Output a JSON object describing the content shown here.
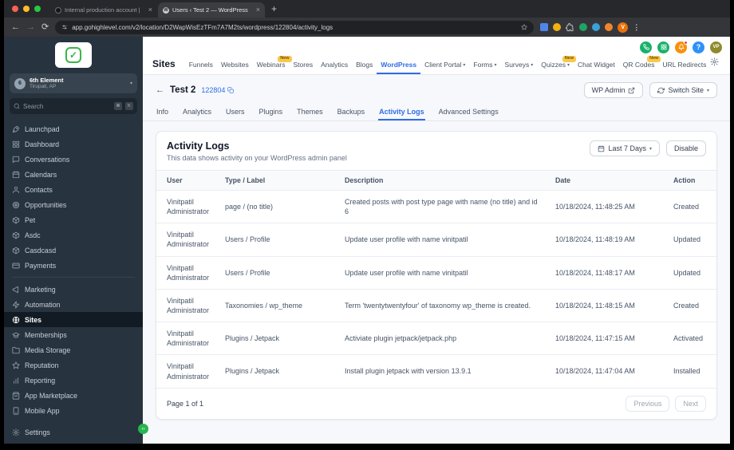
{
  "colors": {
    "accent": "#2f6ce5",
    "sidebar_bg": "#27333f",
    "sidebar_active_bg": "#121a23",
    "badge_bg": "#f7c948",
    "badge_text": "#7a4d0b",
    "green": "#17b26a",
    "orange": "#f79009",
    "blue": "#2e90fa"
  },
  "browser": {
    "tabs": [
      {
        "title": "Internal production account |"
      },
      {
        "title": "Users ‹ Test 2 — WordPress"
      }
    ],
    "url": "app.gohighlevel.com/v2/location/D2WapWisEzTFm7A7M2ts/wordpress/122804/activity_logs",
    "profile_initial": "V"
  },
  "sidebar": {
    "location_name": "6th Element",
    "location_sub": "Tirupati, AP",
    "location_initial": "6",
    "search_placeholder": "Search",
    "shortcut_keys": [
      "⌘",
      "K"
    ],
    "menu": [
      {
        "label": "Launchpad"
      },
      {
        "label": "Dashboard"
      },
      {
        "label": "Conversations"
      },
      {
        "label": "Calendars"
      },
      {
        "label": "Contacts"
      },
      {
        "label": "Opportunities"
      },
      {
        "label": "Pet"
      },
      {
        "label": "Asdc"
      },
      {
        "label": "Casdcasd"
      },
      {
        "label": "Payments"
      }
    ],
    "menu2": [
      {
        "label": "Marketing"
      },
      {
        "label": "Automation"
      },
      {
        "label": "Sites"
      },
      {
        "label": "Memberships"
      },
      {
        "label": "Media Storage"
      },
      {
        "label": "Reputation"
      },
      {
        "label": "Reporting"
      },
      {
        "label": "App Marketplace"
      },
      {
        "label": "Mobile App"
      }
    ],
    "settings_label": "Settings"
  },
  "header": {
    "avatar_initials": "VP",
    "help_glyph": "?"
  },
  "topnav": {
    "section_title": "Sites",
    "items": [
      {
        "label": "Funnels"
      },
      {
        "label": "Websites"
      },
      {
        "label": "Webinars",
        "badge": "New"
      },
      {
        "label": "Stores"
      },
      {
        "label": "Analytics"
      },
      {
        "label": "Blogs"
      },
      {
        "label": "WordPress"
      },
      {
        "label": "Client Portal"
      },
      {
        "label": "Forms"
      },
      {
        "label": "Surveys"
      },
      {
        "label": "Quizzes",
        "badge": "New"
      },
      {
        "label": "Chat Widget"
      },
      {
        "label": "QR Codes",
        "badge": "New"
      },
      {
        "label": "URL Redirects"
      }
    ]
  },
  "page": {
    "back_label": "Test 2",
    "site_id": "122804",
    "wp_admin_label": "WP Admin",
    "switch_site_label": "Switch Site",
    "tabs": [
      "Info",
      "Analytics",
      "Users",
      "Plugins",
      "Themes",
      "Backups",
      "Activity Logs",
      "Advanced Settings"
    ]
  },
  "panel": {
    "title": "Activity Logs",
    "subtitle": "This data shows activity on your WordPress admin panel",
    "date_filter_label": "Last 7 Days",
    "disable_label": "Disable"
  },
  "table": {
    "columns": [
      "User",
      "Type / Label",
      "Description",
      "Date",
      "Action"
    ],
    "rows": [
      {
        "user_name": "Vinitpatil",
        "user_role": "Administrator",
        "type": "page / (no title)",
        "description": "Created posts with post type page with name (no title) and id 6",
        "date": "10/18/2024, 11:48:25 AM",
        "action": "Created"
      },
      {
        "user_name": "Vinitpatil",
        "user_role": "Administrator",
        "type": "Users / Profile",
        "description": "Update user profile with name vinitpatil",
        "date": "10/18/2024, 11:48:19 AM",
        "action": "Updated"
      },
      {
        "user_name": "Vinitpatil",
        "user_role": "Administrator",
        "type": "Users / Profile",
        "description": "Update user profile with name vinitpatil",
        "date": "10/18/2024, 11:48:17 AM",
        "action": "Updated"
      },
      {
        "user_name": "Vinitpatil",
        "user_role": "Administrator",
        "type": "Taxonomies / wp_theme",
        "description": "Term 'twentytwentyfour' of taxonomy wp_theme is created.",
        "date": "10/18/2024, 11:48:15 AM",
        "action": "Created"
      },
      {
        "user_name": "Vinitpatil",
        "user_role": "Administrator",
        "type": "Plugins / Jetpack",
        "description": "Activiate plugin jetpack/jetpack.php",
        "date": "10/18/2024, 11:47:15 AM",
        "action": "Activated"
      },
      {
        "user_name": "Vinitpatil",
        "user_role": "Administrator",
        "type": "Plugins / Jetpack",
        "description": "Install plugin jetpack with version 13.9.1",
        "date": "10/18/2024, 11:47:04 AM",
        "action": "Installed"
      }
    ]
  },
  "pagination": {
    "label": "Page 1 of 1",
    "previous_label": "Previous",
    "next_label": "Next"
  }
}
